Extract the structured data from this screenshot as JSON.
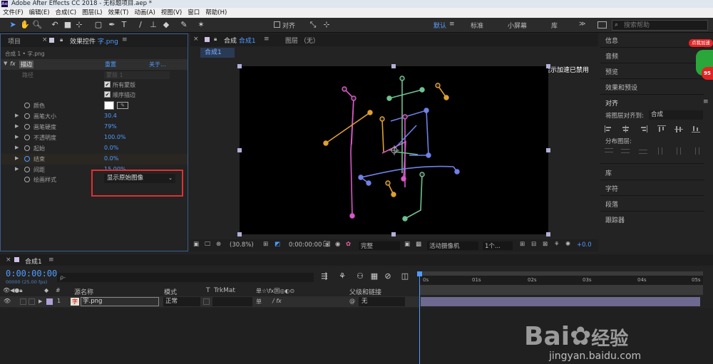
{
  "window": {
    "app_logo": "Ae",
    "title": "Adobe After Effects CC 2018 - 无标题项目.aep *"
  },
  "menu": [
    "文件(F)",
    "编辑(E)",
    "合成(C)",
    "图层(L)",
    "效果(T)",
    "动画(A)",
    "视图(V)",
    "窗口",
    "帮助(H)"
  ],
  "toolbar": {
    "align_label": "对齐",
    "workspaces": [
      "默认",
      "标准",
      "小屏幕",
      "库"
    ],
    "active_workspace": "默认",
    "menu_glyph": "≫",
    "search_placeholder": "搜索帮助"
  },
  "left_panel": {
    "tabs": [
      "项目",
      "效果控件 字.png"
    ],
    "active_tab": "效果控件 字.png",
    "effect_control_prefix": "效果控件",
    "effect_control_target": "字.png",
    "breadcrumb": "合成 1 • 字.png",
    "effect": {
      "fx": "fx",
      "name": "描边",
      "reset": "重置",
      "about": "关于..."
    },
    "path_label": "路径",
    "path_value": "蒙版 1",
    "all_masks": "所有蒙版",
    "sequential": "顺序描边",
    "color_label": "颜色",
    "properties": [
      {
        "label": "画笔大小",
        "value": "30.4"
      },
      {
        "label": "画笔硬度",
        "value": "79%"
      },
      {
        "label": "不透明度",
        "value": "100.0%"
      },
      {
        "label": "起始",
        "value": "0.0%"
      },
      {
        "label": "结束",
        "value": "0.0%"
      },
      {
        "label": "间距",
        "value": "15.00%"
      }
    ],
    "paint_style_label": "绘画样式",
    "paint_style_value": "显示原始图像"
  },
  "comp_panel": {
    "tab": "合成 合成1",
    "tab_prefix": "合成",
    "tab_name": "合成1",
    "layer_tab": "图层 （无）",
    "subtab": "合成1",
    "gpu_notice": "显示加速已禁用",
    "bottom": {
      "zoom": "(30.8%)",
      "timecode": "0:00:00:00",
      "quality": "完整",
      "camera": "活动摄像机",
      "views": "1个...",
      "exposure": "+0.0"
    }
  },
  "right_panel": {
    "items_top": [
      "信息",
      "音频",
      "预览",
      "效果和预设"
    ],
    "align": {
      "title": "对齐",
      "align_to_label": "将图层对齐到:",
      "align_to_value": "合成",
      "distribute_label": "分布图层:"
    },
    "items_bottom": [
      "库",
      "字符",
      "段落",
      "跟踪器"
    ],
    "badge": "点我加速",
    "badge_num": "95"
  },
  "timeline": {
    "tab": "合成1",
    "timecode": "0:00:00:00",
    "frame_info": "00000 (25.00 fps)",
    "search_glyph": "ρ-",
    "ruler": [
      "0s",
      "01s",
      "02s",
      "03s",
      "04s",
      "05s"
    ],
    "columns": {
      "source": "源名称",
      "mode": "模式",
      "t": "T",
      "trkmat": "TrkMat",
      "switches": "单☆\\fx囯◎◐⊙",
      "parent": "父级和链接"
    },
    "layers": [
      {
        "index": "1",
        "name": "字.png",
        "mode": "正常",
        "parent": "无",
        "switch_a": "单",
        "switch_b": "/ fx",
        "parent_icon": "@"
      }
    ]
  },
  "watermark": {
    "brand": "Bai",
    "brand2": "经验",
    "url": "jingyan.baidu.com"
  },
  "colors": {
    "accent": "#4f9bff",
    "highlight_box": "#e03030",
    "panel_bg": "#232323"
  }
}
